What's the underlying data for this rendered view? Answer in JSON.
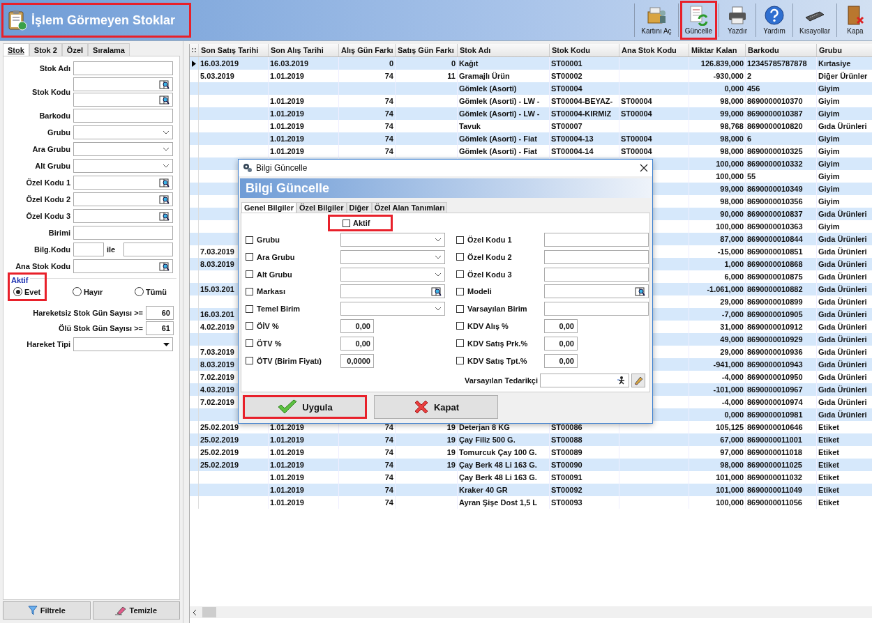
{
  "header": {
    "title": "İşlem Görmeyen Stoklar",
    "highlighted": true
  },
  "toolbar": [
    {
      "label": "Kartını Aç",
      "kind": "open_card",
      "highlighted": false
    },
    {
      "label": "Güncelle",
      "kind": "update",
      "highlighted": true
    },
    {
      "label": "Yazdır",
      "kind": "print",
      "highlighted": false
    },
    {
      "label": "Yardım",
      "kind": "help",
      "highlighted": false
    },
    {
      "label": "Kısayollar",
      "kind": "shortcuts",
      "highlighted": false
    },
    {
      "label": "Kapa",
      "kind": "close",
      "highlighted": false
    }
  ],
  "filter_panel": {
    "tabs": [
      {
        "label": "Stok",
        "selected": true
      },
      {
        "label": "Stok 2",
        "selected": false
      },
      {
        "label": "Özel",
        "selected": false
      },
      {
        "label": "Sıralama",
        "selected": false
      }
    ],
    "fields": [
      {
        "label": "Stok Adı",
        "kind": "text"
      },
      {
        "label": "Stok Kodu",
        "kind": "double_lookup"
      },
      {
        "label": "Barkodu",
        "kind": "text"
      },
      {
        "label": "Grubu",
        "kind": "dropdown"
      },
      {
        "label": "Ara Grubu",
        "kind": "dropdown"
      },
      {
        "label": "Alt Grubu",
        "kind": "dropdown"
      },
      {
        "label": "Özel Kodu 1",
        "kind": "lookup"
      },
      {
        "label": "Özel Kodu 2",
        "kind": "lookup"
      },
      {
        "label": "Özel Kodu 3",
        "kind": "lookup"
      },
      {
        "label": "Birimi",
        "kind": "text"
      },
      {
        "label": "Bilg.Kodu",
        "kind": "range",
        "connector": "ile"
      },
      {
        "label": "Ana Stok Kodu",
        "kind": "lookup"
      }
    ],
    "active_group": {
      "title": "Aktif",
      "highlighted": true,
      "options": [
        {
          "label": "Evet",
          "selected": true
        },
        {
          "label": "Hayır",
          "selected": false
        },
        {
          "label": "Tümü",
          "selected": false
        }
      ]
    },
    "thresholds": [
      {
        "label": "Hareketsiz Stok Gün Sayısı >=",
        "value": "60"
      },
      {
        "label": "Ölü Stok Gün Sayısı >=",
        "value": "61"
      }
    ],
    "movement_type": {
      "label": "Hareket Tipi"
    },
    "buttons": [
      {
        "label": "Filtrele",
        "kind": "filter"
      },
      {
        "label": "Temizle",
        "kind": "clear"
      }
    ]
  },
  "table": {
    "columns": [
      "Son Satış Tarihi",
      "Son Alış Tarihi",
      "Alış Gün Farkı",
      "Satış Gün Farkı",
      "Stok Adı",
      "Stok Kodu",
      "Ana Stok Kodu",
      "Miktar Kalan",
      "Barkodu",
      "Grubu"
    ],
    "rows": [
      {
        "selected": true,
        "cells": [
          "16.03.2019",
          "16.03.2019",
          "0",
          "0",
          "Kağıt",
          "ST00001",
          null,
          "126.839,000",
          "12345785787878",
          "Kırtasiye"
        ]
      },
      {
        "selected": false,
        "cells": [
          "5.03.2019",
          "1.01.2019",
          "74",
          "11",
          "Gramajlı Ürün",
          "ST00002",
          null,
          "-930,000",
          "2",
          "Diğer Ürünler"
        ]
      },
      {
        "selected": false,
        "cells": [
          null,
          null,
          null,
          null,
          "Gömlek (Asorti)",
          "ST00004",
          null,
          "0,000",
          "456",
          "Giyim"
        ]
      },
      {
        "selected": false,
        "cells": [
          null,
          "1.01.2019",
          "74",
          null,
          "Gömlek (Asorti) - LW -",
          "ST00004-BEYAZ-",
          "ST00004",
          "98,000",
          "8690000010370",
          "Giyim"
        ]
      },
      {
        "selected": false,
        "cells": [
          null,
          "1.01.2019",
          "74",
          null,
          "Gömlek (Asorti) - LW -",
          "ST00004-KIRMIZ",
          "ST00004",
          "99,000",
          "8690000010387",
          "Giyim"
        ]
      },
      {
        "selected": false,
        "cells": [
          null,
          "1.01.2019",
          "74",
          null,
          "Tavuk",
          "ST00007",
          null,
          "98,768",
          "8690000010820",
          "Gıda Ürünleri"
        ]
      },
      {
        "selected": false,
        "cells": [
          null,
          "1.01.2019",
          "74",
          null,
          "Gömlek (Asorti) - Fiat",
          "ST00004-13",
          "ST00004",
          "98,000",
          "6",
          "Giyim"
        ]
      },
      {
        "selected": false,
        "cells": [
          null,
          "1.01.2019",
          "74",
          null,
          "Gömlek (Asorti) - Fiat",
          "ST00004-14",
          "ST00004",
          "98,000",
          "8690000010325",
          "Giyim"
        ]
      },
      {
        "selected": false,
        "cells": [
          null,
          null,
          null,
          null,
          null,
          null,
          null,
          "100,000",
          "8690000010332",
          "Giyim"
        ]
      },
      {
        "selected": false,
        "cells": [
          null,
          null,
          null,
          null,
          null,
          null,
          null,
          "100,000",
          "55",
          "Giyim"
        ]
      },
      {
        "selected": false,
        "cells": [
          null,
          null,
          null,
          null,
          null,
          null,
          null,
          "99,000",
          "8690000010349",
          "Giyim"
        ]
      },
      {
        "selected": false,
        "cells": [
          null,
          null,
          null,
          null,
          null,
          null,
          null,
          "98,000",
          "8690000010356",
          "Giyim"
        ]
      },
      {
        "selected": false,
        "cells": [
          null,
          null,
          null,
          null,
          null,
          null,
          null,
          "90,000",
          "8690000010837",
          "Gıda Ürünleri"
        ]
      },
      {
        "selected": false,
        "cells": [
          null,
          null,
          null,
          null,
          null,
          null,
          null,
          "100,000",
          "8690000010363",
          "Giyim"
        ]
      },
      {
        "selected": false,
        "cells": [
          null,
          null,
          null,
          null,
          null,
          null,
          null,
          "87,000",
          "8690000010844",
          "Gıda Ürünleri"
        ]
      },
      {
        "selected": false,
        "cells": [
          "7.03.2019",
          null,
          null,
          null,
          null,
          null,
          null,
          "-15,000",
          "8690000010851",
          "Gıda Ürünleri"
        ]
      },
      {
        "selected": false,
        "cells": [
          "8.03.2019",
          null,
          null,
          null,
          null,
          null,
          null,
          "1,000",
          "8690000010868",
          "Gıda Ürünleri"
        ]
      },
      {
        "selected": false,
        "cells": [
          null,
          null,
          null,
          null,
          null,
          null,
          null,
          "6,000",
          "8690000010875",
          "Gıda Ürünleri"
        ]
      },
      {
        "selected": false,
        "cells": [
          "15.03.201",
          null,
          null,
          null,
          null,
          null,
          null,
          "-1.061,000",
          "8690000010882",
          "Gıda Ürünleri"
        ]
      },
      {
        "selected": false,
        "cells": [
          null,
          null,
          null,
          null,
          null,
          null,
          null,
          "29,000",
          "8690000010899",
          "Gıda Ürünleri"
        ]
      },
      {
        "selected": false,
        "cells": [
          "16.03.201",
          null,
          null,
          null,
          null,
          null,
          null,
          "-7,000",
          "8690000010905",
          "Gıda Ürünleri"
        ]
      },
      {
        "selected": false,
        "cells": [
          "4.02.2019",
          null,
          null,
          null,
          null,
          null,
          null,
          "31,000",
          "8690000010912",
          "Gıda Ürünleri"
        ]
      },
      {
        "selected": false,
        "cells": [
          null,
          null,
          null,
          null,
          null,
          null,
          null,
          "49,000",
          "8690000010929",
          "Gıda Ürünleri"
        ]
      },
      {
        "selected": false,
        "cells": [
          "7.03.2019",
          null,
          null,
          null,
          null,
          null,
          null,
          "29,000",
          "8690000010936",
          "Gıda Ürünleri"
        ]
      },
      {
        "selected": false,
        "cells": [
          "8.03.2019",
          null,
          null,
          null,
          null,
          null,
          null,
          "-941,000",
          "8690000010943",
          "Gıda Ürünleri"
        ]
      },
      {
        "selected": false,
        "cells": [
          "7.02.2019",
          null,
          null,
          null,
          null,
          null,
          null,
          "-4,000",
          "8690000010950",
          "Gıda Ürünleri"
        ]
      },
      {
        "selected": false,
        "cells": [
          "4.03.2019",
          null,
          null,
          null,
          null,
          null,
          null,
          "-101,000",
          "8690000010967",
          "Gıda Ürünleri"
        ]
      },
      {
        "selected": false,
        "cells": [
          "7.02.2019",
          null,
          null,
          null,
          null,
          null,
          null,
          "-4,000",
          "8690000010974",
          "Gıda Ürünleri"
        ]
      },
      {
        "selected": false,
        "cells": [
          null,
          null,
          null,
          null,
          null,
          null,
          null,
          "0,000",
          "8690000010981",
          "Gıda Ürünleri"
        ]
      },
      {
        "selected": false,
        "cells": [
          "25.02.2019",
          "1.01.2019",
          "74",
          "19",
          "Deterjan 8 KG",
          "ST00086",
          null,
          "105,125",
          "8690000010646",
          "Etiket"
        ]
      },
      {
        "selected": false,
        "cells": [
          "25.02.2019",
          "1.01.2019",
          "74",
          "19",
          "Çay Filiz 500 G.",
          "ST00088",
          null,
          "67,000",
          "8690000011001",
          "Etiket"
        ]
      },
      {
        "selected": false,
        "cells": [
          "25.02.2019",
          "1.01.2019",
          "74",
          "19",
          "Tomurcuk Çay 100 G.",
          "ST00089",
          null,
          "97,000",
          "8690000011018",
          "Etiket"
        ]
      },
      {
        "selected": false,
        "cells": [
          "25.02.2019",
          "1.01.2019",
          "74",
          "19",
          "Çay Berk 48 Li 163 G.",
          "ST00090",
          null,
          "98,000",
          "8690000011025",
          "Etiket"
        ]
      },
      {
        "selected": false,
        "cells": [
          null,
          "1.01.2019",
          "74",
          null,
          "Çay Berk 48 Li 163 G.",
          "ST00091",
          null,
          "101,000",
          "8690000011032",
          "Etiket"
        ]
      },
      {
        "selected": false,
        "cells": [
          null,
          "1.01.2019",
          "74",
          null,
          "Kraker 40 GR",
          "ST00092",
          null,
          "101,000",
          "8690000011049",
          "Etiket"
        ]
      },
      {
        "selected": false,
        "cells": [
          null,
          "1.01.2019",
          "74",
          null,
          "Ayran Şişe Dost 1,5 L",
          "ST00093",
          null,
          "100,000",
          "8690000011056",
          "Etiket"
        ]
      }
    ]
  },
  "dialog": {
    "window_title": "Bilgi Güncelle",
    "heading": "Bilgi Güncelle",
    "tabs": [
      {
        "label": "Genel Bilgiler",
        "selected": true
      },
      {
        "label": "Özel Bilgiler",
        "selected": false
      },
      {
        "label": "Diğer",
        "selected": false
      },
      {
        "label": "Özel Alan Tanımları",
        "selected": false
      }
    ],
    "active": {
      "label": "Aktif",
      "checked": false,
      "highlighted": true
    },
    "left_fields": [
      {
        "label": "Grubu",
        "kind": "dropdown",
        "checked": false
      },
      {
        "label": "Ara Grubu",
        "kind": "dropdown",
        "checked": false
      },
      {
        "label": "Alt Grubu",
        "kind": "dropdown",
        "checked": false
      },
      {
        "label": "Markası",
        "kind": "lookup",
        "checked": false
      },
      {
        "label": "Temel Birim",
        "kind": "dropdown",
        "checked": false
      },
      {
        "label": "ÖİV %",
        "kind": "number",
        "value": "0,00",
        "checked": false
      },
      {
        "label": "ÖTV %",
        "kind": "number",
        "value": "0,00",
        "checked": false
      },
      {
        "label": "ÖTV (Birim Fiyatı)",
        "kind": "number",
        "value": "0,0000",
        "checked": false
      }
    ],
    "right_fields": [
      {
        "label": "Özel Kodu 1",
        "kind": "text",
        "checked": false
      },
      {
        "label": "Özel Kodu 2",
        "kind": "text",
        "checked": false
      },
      {
        "label": "Özel Kodu 3",
        "kind": "text",
        "checked": false
      },
      {
        "label": "Modeli",
        "kind": "lookup",
        "checked": false
      },
      {
        "label": "Varsayılan Birim",
        "kind": "text",
        "checked": false
      },
      {
        "label": "KDV Alış %",
        "kind": "number",
        "value": "0,00",
        "checked": false
      },
      {
        "label": "KDV Satış Prk.%",
        "kind": "number",
        "value": "0,00",
        "checked": false
      },
      {
        "label": "KDV Satış Tpt.%",
        "kind": "number",
        "value": "0,00",
        "checked": false
      }
    ],
    "supplier": {
      "label": "Varsayılan Tedarikçi"
    },
    "buttons": [
      {
        "label": "Uygula",
        "kind": "apply",
        "highlighted": true
      },
      {
        "label": "Kapat",
        "kind": "cancel",
        "highlighted": false
      }
    ]
  }
}
